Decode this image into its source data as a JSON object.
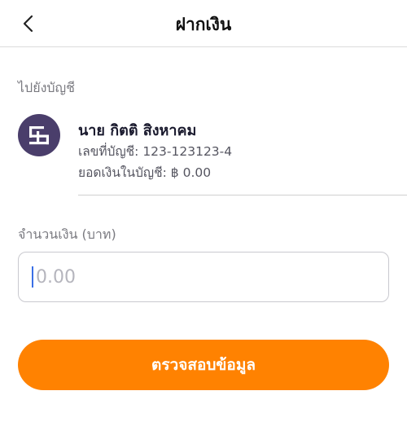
{
  "header": {
    "title": "ฝากเงิน"
  },
  "destination": {
    "section_label": "ไปยังบัญชี",
    "account_name": "นาย กิตติ สิงหาคม",
    "account_number_line": "เลขที่บัญชี: 123-123123-4",
    "balance_line": "ยอดเงินในบัญชี: ฿ 0.00",
    "avatar_color": "#4a3e6b"
  },
  "amount": {
    "label": "จำนวนเงิน (บาท)",
    "placeholder": "0.00",
    "value": ""
  },
  "actions": {
    "submit_label": "ตรวจสอบข้อมูล",
    "submit_color": "#ff8201"
  },
  "icons": {
    "back": "chevron-left-icon",
    "avatar": "bank-logo-icon"
  }
}
